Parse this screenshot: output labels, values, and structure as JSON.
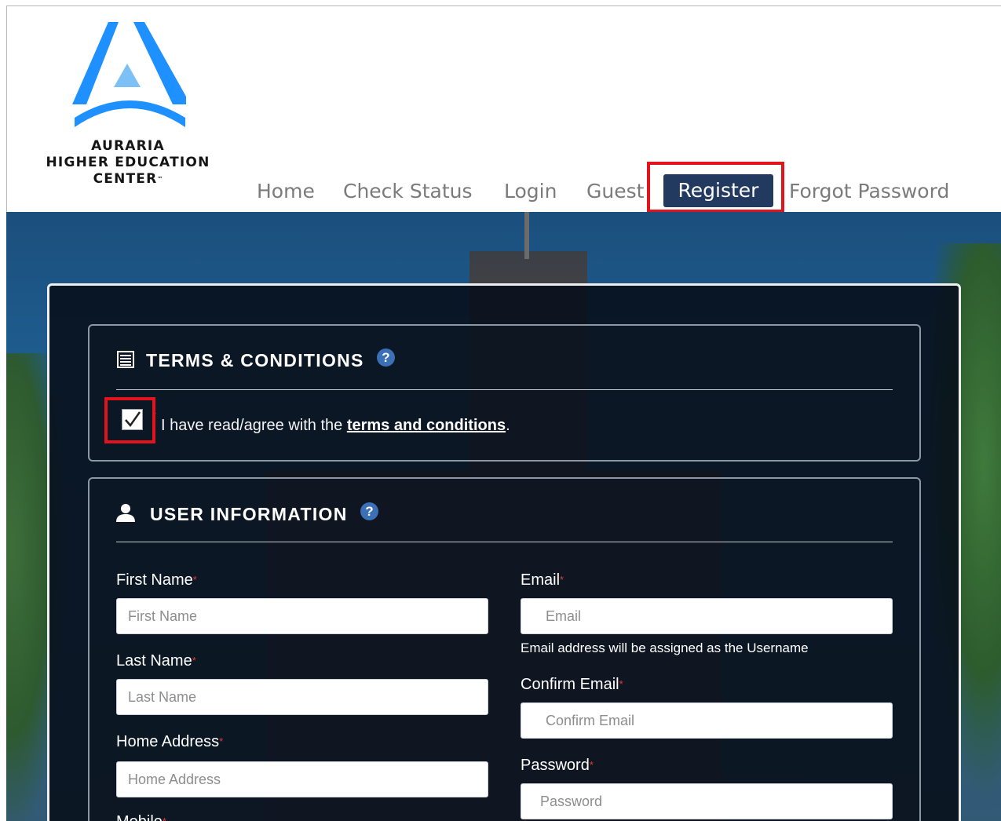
{
  "logo": {
    "line1": "AURARIA",
    "line2": "HIGHER EDUCATION",
    "line3": "CENTER",
    "trademark": "™",
    "brand_color": "#1e90ff"
  },
  "nav": {
    "home": "Home",
    "check_status": "Check Status",
    "login": "Login",
    "guest": "Guest",
    "register": "Register",
    "forgot_password": "Forgot Password",
    "active_bg": "#223a60",
    "highlight_color": "#e3131b"
  },
  "terms": {
    "icon": "list-icon",
    "title": "TERMS & CONDITIONS",
    "help": "?",
    "required_mark": "*",
    "agree_prefix": "I have read/agree with the ",
    "agree_link": "terms and conditions",
    "agree_suffix": ".",
    "checked": true
  },
  "user_info": {
    "icon": "user-icon",
    "title": "USER INFORMATION",
    "help": "?",
    "required_mark": "*",
    "first_name": {
      "label": "First Name",
      "placeholder": "First Name"
    },
    "last_name": {
      "label": "Last Name",
      "placeholder": "Last Name"
    },
    "home_address": {
      "label": "Home Address",
      "placeholder": "Home Address"
    },
    "mobile": {
      "label": "Mobile"
    },
    "email": {
      "label": "Email",
      "placeholder": "Email",
      "hint": "Email address will be assigned as the Username"
    },
    "confirm_email": {
      "label": "Confirm Email",
      "placeholder": "Confirm Email"
    },
    "password": {
      "label": "Password",
      "placeholder": "Password"
    }
  }
}
